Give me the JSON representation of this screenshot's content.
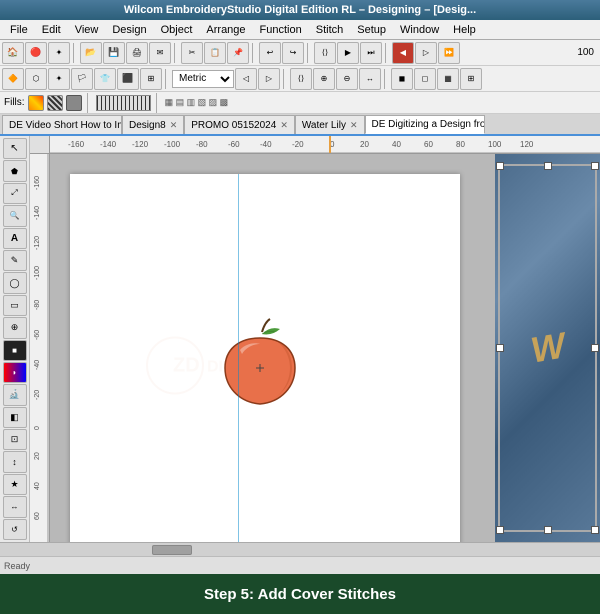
{
  "title_bar": {
    "text": "Wilcom EmbroideryStudio Digital Edition RL – Designing – [Desig..."
  },
  "menu": {
    "items": [
      "File",
      "Edit",
      "View",
      "Design",
      "Object",
      "Arrange",
      "Function",
      "Stitch",
      "Setup",
      "Window",
      "Help"
    ]
  },
  "tabs": [
    {
      "label": "DE Video Short How to Import and...",
      "active": false
    },
    {
      "label": "Design8",
      "active": false
    },
    {
      "label": "PROMO 05152024",
      "active": false
    },
    {
      "label": "Water Lily",
      "active": false
    },
    {
      "label": "DE Digitizing a Design from a Grap...",
      "active": true
    }
  ],
  "fills_label": "Fills:",
  "watermark": {
    "line1": "ZD DIGITIZING"
  },
  "apple": {
    "description": "peach/apple illustration with leaf and stem"
  },
  "right_panel": {
    "cursive_text": "W"
  },
  "bottom_bar": {
    "text": "Step 5: Add Cover Stitches"
  },
  "toolbar": {
    "metric_label": "Metric",
    "zoom_value": "100"
  },
  "left_tools": [
    "↖",
    "↗",
    "✦",
    "⬟",
    "A",
    "✎",
    "◯",
    "▭",
    "✂",
    "⊕",
    "⊞",
    "⬡",
    "▦",
    "◈",
    "⛽",
    "🔍",
    "⬆",
    "⬇",
    "↺",
    "🎨"
  ]
}
